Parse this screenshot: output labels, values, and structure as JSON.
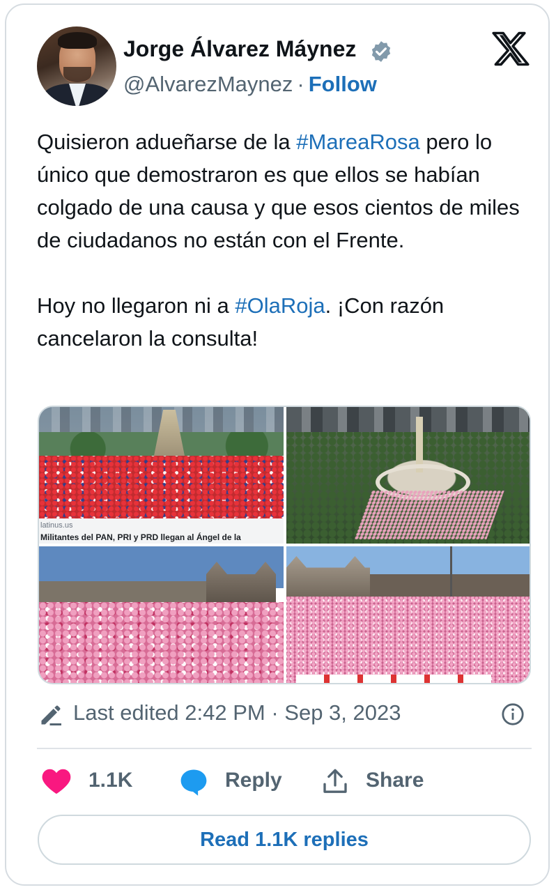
{
  "author": {
    "name": "Jorge Álvarez Máynez",
    "handle": "@AlvarezMaynez",
    "separator": "·",
    "follow_label": "Follow",
    "verified": true
  },
  "tweet": {
    "paragraph_1": {
      "before": "Quisieron adueñarse de la ",
      "hashtag": "#MareaRosa",
      "after": " pero lo único que demostraron es que ellos se habían colgado de una causa y que esos cientos de miles de ciudadanos no están con el Frente."
    },
    "paragraph_2": {
      "before": "Hoy no llegaron ni a ",
      "hashtag": "#OlaRoja",
      "after": ". ¡Con razón cancelaron la consulta!"
    }
  },
  "media": {
    "photo_1": {
      "site": "latinus.us",
      "headline": "Militantes del PAN, PRI y PRD llegan al Ángel de la"
    }
  },
  "meta": {
    "edited_text": "Last edited 2:42 PM · Sep 3, 2023"
  },
  "actions": {
    "like_count": "1.1K",
    "reply_label": "Reply",
    "share_label": "Share"
  },
  "read_replies_label": "Read 1.1K replies",
  "colors": {
    "accent": "#1d6fb8",
    "like": "#f91880",
    "reply_icon": "#1d9bf0",
    "verified_badge": "#829aab",
    "secondary_text": "#536471"
  },
  "icons": {
    "verified": "verified-badge-icon",
    "brand": "x-logo-icon",
    "edited": "pencil-icon",
    "info": "info-icon",
    "like": "heart-icon",
    "reply": "speech-bubble-icon",
    "share": "share-upload-icon"
  }
}
